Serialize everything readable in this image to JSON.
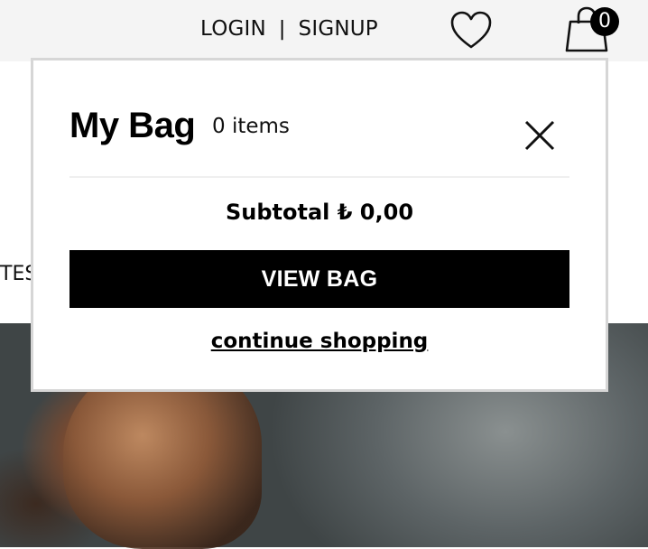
{
  "header": {
    "login_label": "LOGIN",
    "separator": "|",
    "signup_label": "SIGNUP",
    "cart_count": "0"
  },
  "background": {
    "partial_text": "TES"
  },
  "mini_bag": {
    "title": "My Bag",
    "item_count_label": "0 items",
    "subtotal_label": "Subtotal ₺ 0,00",
    "view_bag_label": "VIEW BAG",
    "continue_label": "continue shopping"
  },
  "colors": {
    "topbar_bg": "#f4f4f4",
    "button_bg": "#000000",
    "button_text": "#ffffff",
    "panel_border": "#d6d6d6"
  }
}
